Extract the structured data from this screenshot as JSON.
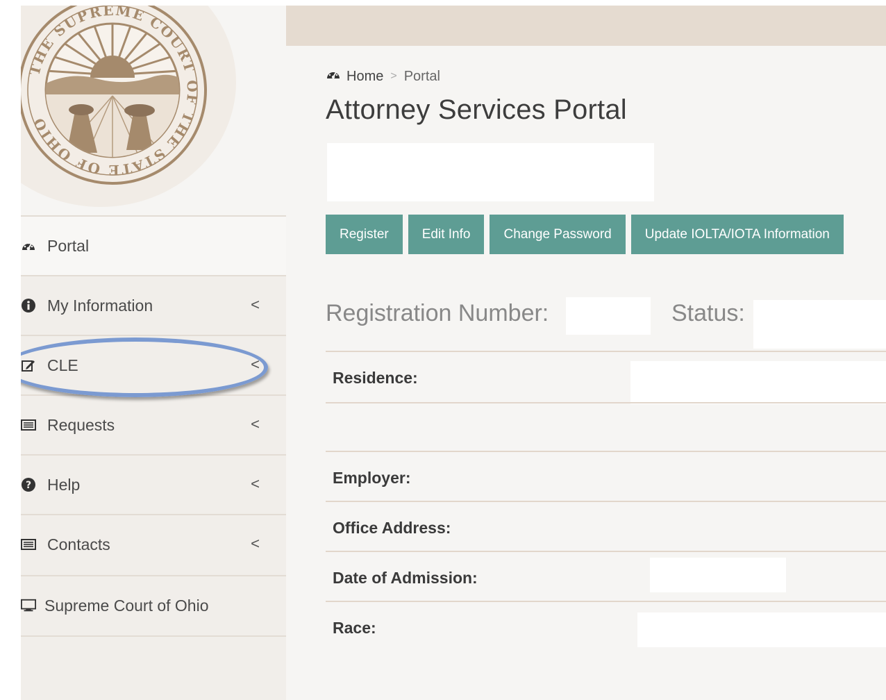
{
  "logo": {
    "seal_text": "THE SUPREME COURT OF THE STATE OF OHIO"
  },
  "sidebar": {
    "items": [
      {
        "label": "Portal",
        "icon": "dashboard-icon",
        "has_chevron": false
      },
      {
        "label": "My Information",
        "icon": "info-icon",
        "has_chevron": true
      },
      {
        "label": "CLE",
        "icon": "edit-icon",
        "has_chevron": true
      },
      {
        "label": "Requests",
        "icon": "list-icon",
        "has_chevron": true
      },
      {
        "label": "Help",
        "icon": "question-icon",
        "has_chevron": true
      },
      {
        "label": "Contacts",
        "icon": "list-icon",
        "has_chevron": true
      },
      {
        "label": "Supreme Court of Ohio",
        "icon": "monitor-icon",
        "has_chevron": false
      }
    ],
    "chevron_glyph": "<"
  },
  "breadcrumb": {
    "home": "Home",
    "separator": ">",
    "current": "Portal"
  },
  "page_title": "Attorney Services Portal",
  "buttons": {
    "register": "Register",
    "edit_info": "Edit Info",
    "change_password": "Change Password",
    "update_iolta": "Update IOLTA/IOTA Information"
  },
  "profile": {
    "registration_label": "Registration Number:",
    "status_label": "Status:",
    "residence_label": "Residence:",
    "employer_label": "Employer:",
    "office_address_label": "Office Address:",
    "admission_label": "Date of Admission:",
    "race_label": "Race:"
  },
  "colors": {
    "button": "#5e9d94",
    "top_bar": "#e5dbd0",
    "highlight_oval": "#7b9ad1",
    "seal": "#a58a6c"
  }
}
